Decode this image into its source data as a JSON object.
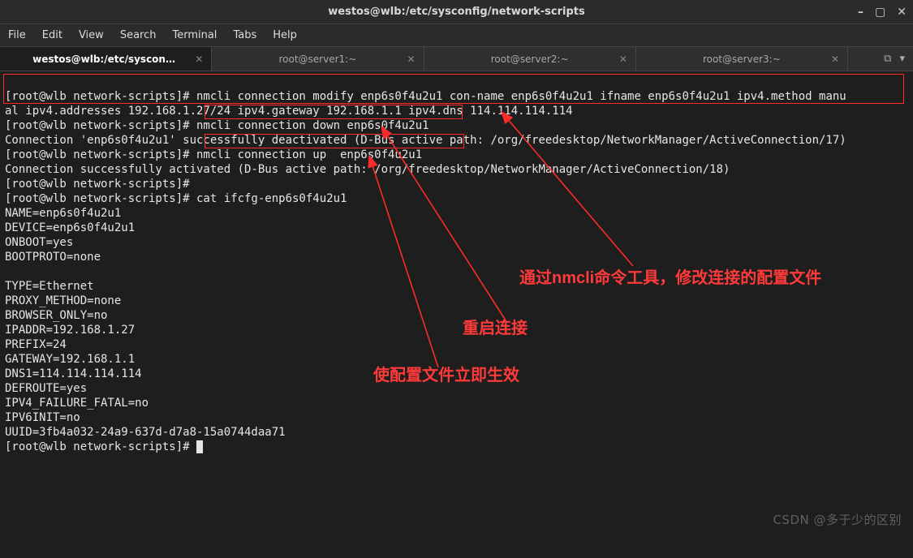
{
  "window": {
    "title": "westos@wlb:/etc/sysconfig/network-scripts",
    "buttons": {
      "min": "–",
      "max": "▢",
      "close": "✕"
    }
  },
  "menu": [
    "File",
    "Edit",
    "View",
    "Search",
    "Terminal",
    "Tabs",
    "Help"
  ],
  "tabs": [
    {
      "label": "westos@wlb:/etc/sysconfi…",
      "active": true
    },
    {
      "label": "root@server1:~",
      "active": false
    },
    {
      "label": "root@server2:~",
      "active": false
    },
    {
      "label": "root@server3:~",
      "active": false
    }
  ],
  "tabtools": {
    "open": "⧉",
    "menu": "▾"
  },
  "terminal": {
    "l1": "[root@wlb network-scripts]# nmcli connection modify enp6s0f4u2u1 con-name enp6s0f4u2u1 ifname enp6s0f4u2u1 ipv4.method manu",
    "l2": "al ipv4.addresses 192.168.1.27/24 ipv4.gateway 192.168.1.1 ipv4.dns 114.114.114.114",
    "l3": "[root@wlb network-scripts]# nmcli connection down enp6s0f4u2u1",
    "l4": "Connection 'enp6s0f4u2u1' successfully deactivated (D-Bus active path: /org/freedesktop/NetworkManager/ActiveConnection/17)",
    "l5": "[root@wlb network-scripts]# nmcli connection up  enp6s0f4u2u1",
    "l6": "Connection successfully activated (D-Bus active path: /org/freedesktop/NetworkManager/ActiveConnection/18)",
    "l7": "[root@wlb network-scripts]# ",
    "l8": "[root@wlb network-scripts]# cat ifcfg-enp6s0f4u2u1",
    "l9": "NAME=enp6s0f4u2u1",
    "l10": "DEVICE=enp6s0f4u2u1",
    "l11": "ONBOOT=yes",
    "l12": "BOOTPROTO=none",
    "l13": "",
    "l14": "TYPE=Ethernet",
    "l15": "PROXY_METHOD=none",
    "l16": "BROWSER_ONLY=no",
    "l17": "IPADDR=192.168.1.27",
    "l18": "PREFIX=24",
    "l19": "GATEWAY=192.168.1.1",
    "l20": "DNS1=114.114.114.114",
    "l21": "DEFROUTE=yes",
    "l22": "IPV4_FAILURE_FATAL=no",
    "l23": "IPV6INIT=no",
    "l24": "UUID=3fb4a032-24a9-637d-d7a8-15a0744daa71",
    "l25": "[root@wlb network-scripts]# "
  },
  "annotations": {
    "a1": "通过nmcli命令工具，修改连接的配置文件",
    "a2": "重启连接",
    "a3": "使配置文件立即生效"
  },
  "watermark": "CSDN @多于少的区别"
}
